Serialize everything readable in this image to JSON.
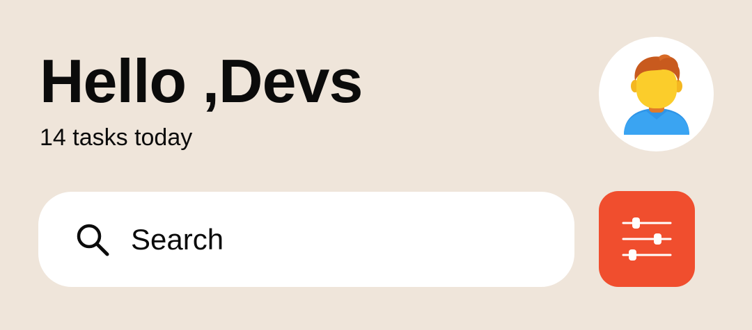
{
  "header": {
    "greeting": "Hello ,Devs",
    "subtitle": "14 tasks today",
    "avatar_icon": "person-avatar-icon"
  },
  "search": {
    "placeholder": "Search",
    "icon": "search-icon"
  },
  "filter": {
    "icon": "sliders-icon",
    "color": "#f04e2e"
  },
  "colors": {
    "background": "#efe5da",
    "surface": "#ffffff",
    "text": "#0b0b0b",
    "accent": "#f04e2e"
  }
}
